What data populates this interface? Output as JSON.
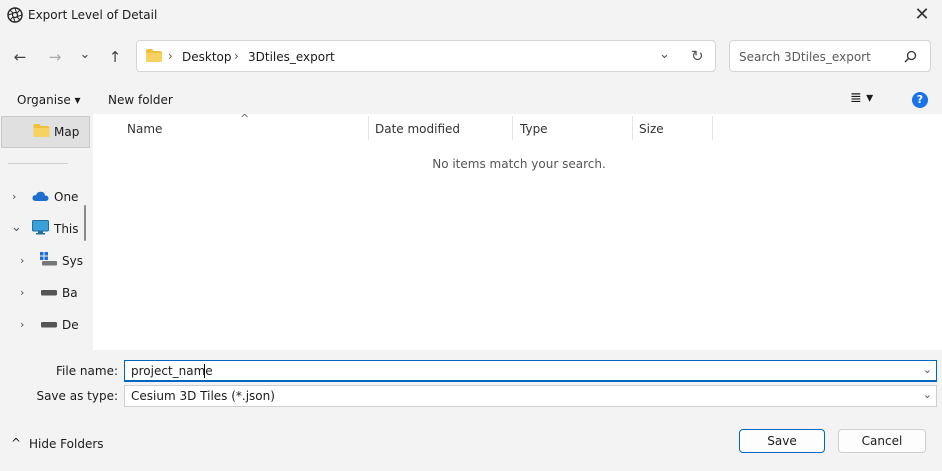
{
  "window": {
    "title": "Export Level of Detail",
    "close_glyph": "✕",
    "app_icon": "aperture-icon"
  },
  "nav": {
    "back_glyph": "←",
    "forward_glyph": "→",
    "recent_glyph": "⌄",
    "up_glyph": "↑",
    "refresh_glyph": "↻",
    "address_dropdown_glyph": "⌄"
  },
  "address": {
    "crumbs": [
      "Desktop",
      "3Dtiles_export"
    ],
    "sep": "›"
  },
  "search": {
    "placeholder": "Search 3Dtiles_export",
    "icon_glyph": "⌕"
  },
  "toolbar": {
    "organise": "Organise ▾",
    "new_folder": "New folder",
    "view_glyph": "≣ ▾",
    "help_glyph": "?"
  },
  "sidebar": {
    "selected": "Map",
    "items": [
      {
        "chev": "›",
        "label": "One"
      },
      {
        "chev": "⌄",
        "label": "This"
      },
      {
        "chev": "›",
        "label": "Sys"
      },
      {
        "chev": "›",
        "label": "Ba"
      },
      {
        "chev": "›",
        "label": "De"
      }
    ]
  },
  "columns": [
    "Name",
    "Date modified",
    "Type",
    "Size"
  ],
  "sort_glyph": "^",
  "empty_message": "No items match your search.",
  "form": {
    "file_name_label": "File name:",
    "file_name_value": "project_name",
    "save_type_label": "Save as type:",
    "save_type_value": "Cesium 3D Tiles (*.json)",
    "dd_glyph": "⌄"
  },
  "footer": {
    "hide_folders": "Hide Folders",
    "hide_glyph": "^",
    "save": "Save",
    "cancel": "Cancel"
  },
  "colors": {
    "accent": "#0067c0",
    "folder": "#f0c040",
    "help": "#1a73e8"
  }
}
